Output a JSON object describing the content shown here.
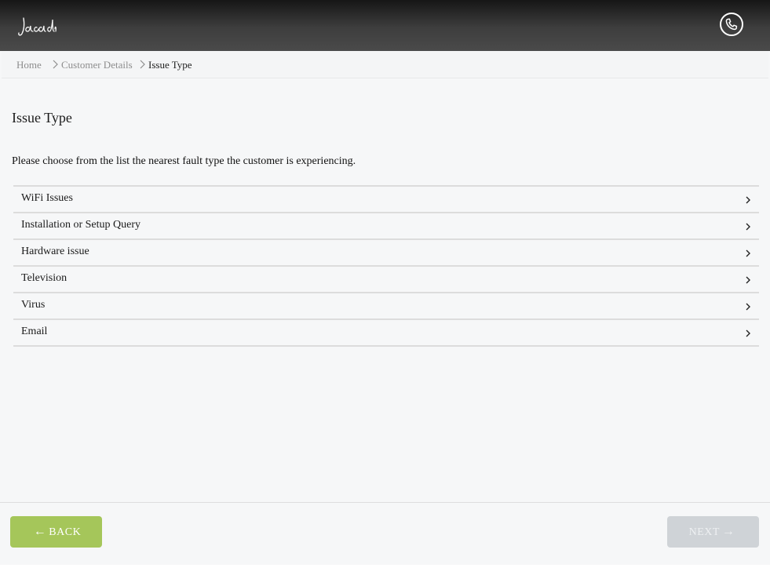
{
  "header": {
    "logo_text": "Jacada",
    "phone_icon": "phone-icon"
  },
  "breadcrumb": {
    "items": [
      "Home",
      "Customer Details",
      "Issue Type"
    ]
  },
  "main": {
    "title": "Issue Type",
    "instructions": "Please choose from the list the nearest fault type the customer is experiencing.",
    "issues": [
      {
        "label": "WiFi Issues"
      },
      {
        "label": "Installation or Setup Query"
      },
      {
        "label": "Hardware issue"
      },
      {
        "label": "Television"
      },
      {
        "label": "Virus"
      },
      {
        "label": "Email"
      }
    ]
  },
  "footer": {
    "back_label": "BACK",
    "next_label": "NEXT",
    "back_color": "#a5c65a",
    "next_color": "#cfd3d7"
  }
}
